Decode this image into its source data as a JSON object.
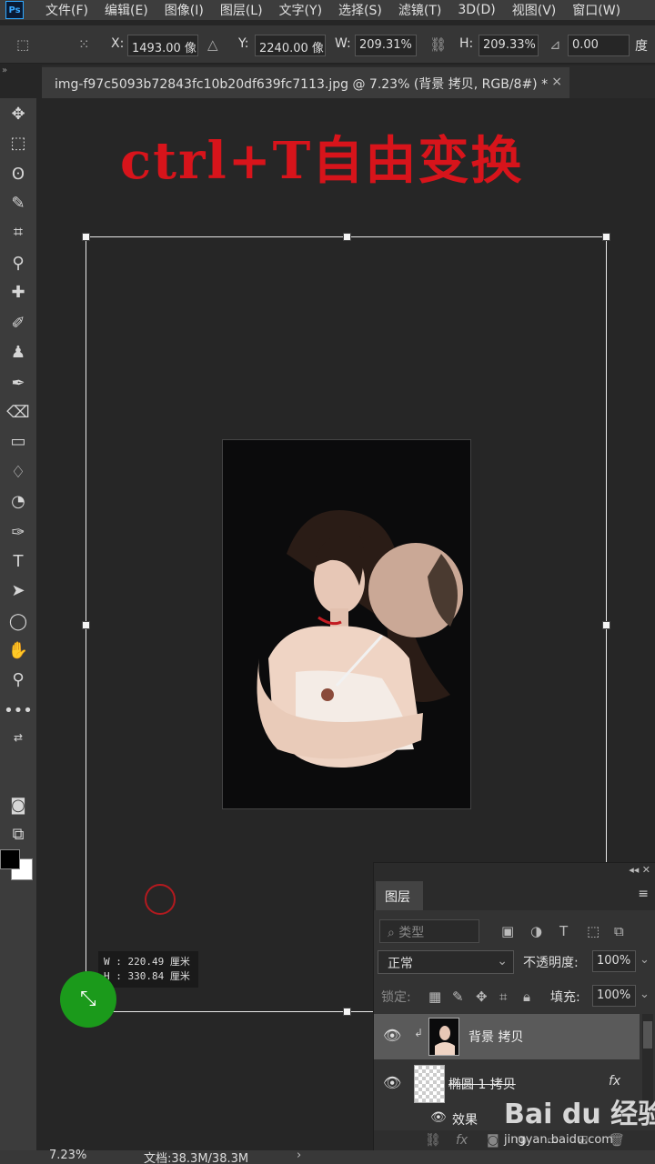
{
  "app": {
    "logo": "Ps"
  },
  "menu": {
    "items": [
      "文件(F)",
      "编辑(E)",
      "图像(I)",
      "图层(L)",
      "文字(Y)",
      "选择(S)",
      "滤镜(T)",
      "3D(D)",
      "视图(V)",
      "窗口(W)"
    ]
  },
  "options": {
    "x_label": "X:",
    "x_value": "1493.00 像",
    "y_label": "Y:",
    "y_value": "2240.00 像",
    "w_label": "W:",
    "w_value": "209.31%",
    "h_label": "H:",
    "h_value": "209.33%",
    "angle_value": "0.00",
    "angle_unit": "度"
  },
  "tab": {
    "title": "img-f97c5093b72843fc10b20df639fc7113.jpg @ 7.23% (背景 拷贝, RGB/8#) *",
    "close": "×"
  },
  "overlay": {
    "title": "ctrl+T自由变换"
  },
  "transform_tip": {
    "w": "W :  220.49 厘米",
    "h": "H :  330.84 厘米"
  },
  "layers_panel": {
    "tab_label": "图层",
    "filter_kind": "类型",
    "blend_mode": "正常",
    "opacity_label": "不透明度:",
    "opacity_value": "100%",
    "lock_label": "锁定:",
    "fill_label": "填充:",
    "fill_value": "100%",
    "layers": [
      {
        "name": "背景 拷贝",
        "selected": true
      },
      {
        "name": "椭圆 1 拷贝",
        "fx": "fx"
      }
    ],
    "effects_label": "效果"
  },
  "status": {
    "zoom": "7.23%",
    "doc": "文档:38.3M/38.3M"
  },
  "watermark": {
    "logo": "Bai du 经验",
    "url": "jingyan.baidu.com"
  },
  "colors": {
    "accent_red": "#d7141b",
    "cursor_green": "#1b9a1b"
  }
}
